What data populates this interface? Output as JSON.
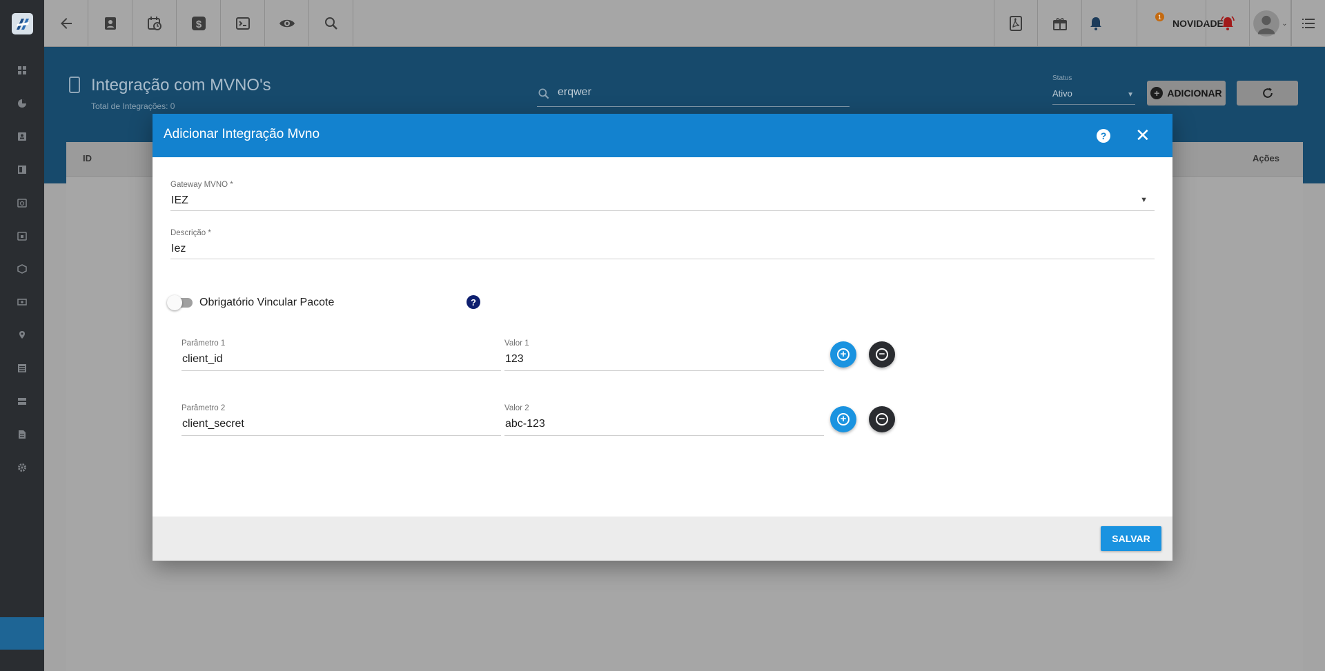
{
  "topbar": {
    "novidades_label": "NOVIDADES",
    "notification_count": "1"
  },
  "header": {
    "title": "Integração com MVNO's",
    "subtitle": "Total de Integrações: 0",
    "search_value": "erqwer",
    "status_label": "Status",
    "status_value": "Ativo",
    "add_label": "ADICIONAR"
  },
  "table": {
    "col_id": "ID",
    "col_actions": "Ações"
  },
  "modal": {
    "title": "Adicionar Integração Mvno",
    "gateway_label": "Gateway MVNO *",
    "gateway_value": "IEZ",
    "descricao_label": "Descrição *",
    "descricao_value": "Iez",
    "toggle_label": "Obrigatório Vincular Pacote",
    "params": [
      {
        "param_label": "Parâmetro 1",
        "param_value": "client_id",
        "valor_label": "Valor 1",
        "valor_value": "123"
      },
      {
        "param_label": "Parâmetro 2",
        "param_value": "client_secret",
        "valor_label": "Valor 2",
        "valor_value": "abc-123"
      }
    ],
    "save_label": "SALVAR"
  },
  "colors": {
    "primary": "#1382cf",
    "accent": "#1a93e0",
    "sidebar": "#2a2d31"
  }
}
